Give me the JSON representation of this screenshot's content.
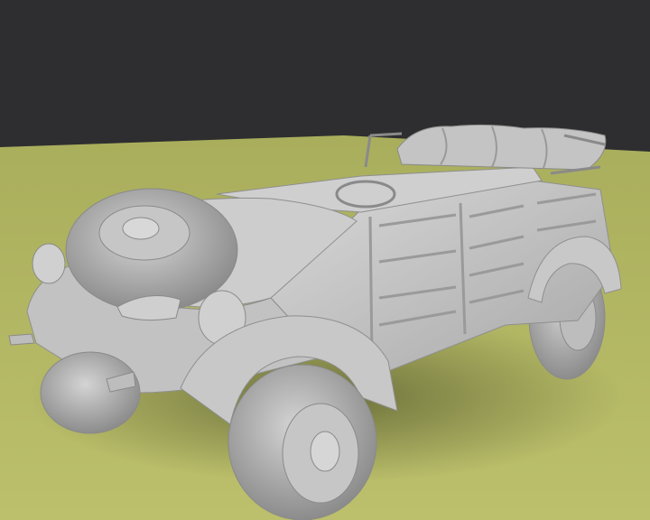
{
  "scene": {
    "subject": "car-icon",
    "colors": {
      "backdrop": "#2e2e30",
      "ground": "#b8bd6a",
      "vehicle": "#c9c9c9",
      "shadow": "#6b6f3a"
    }
  }
}
